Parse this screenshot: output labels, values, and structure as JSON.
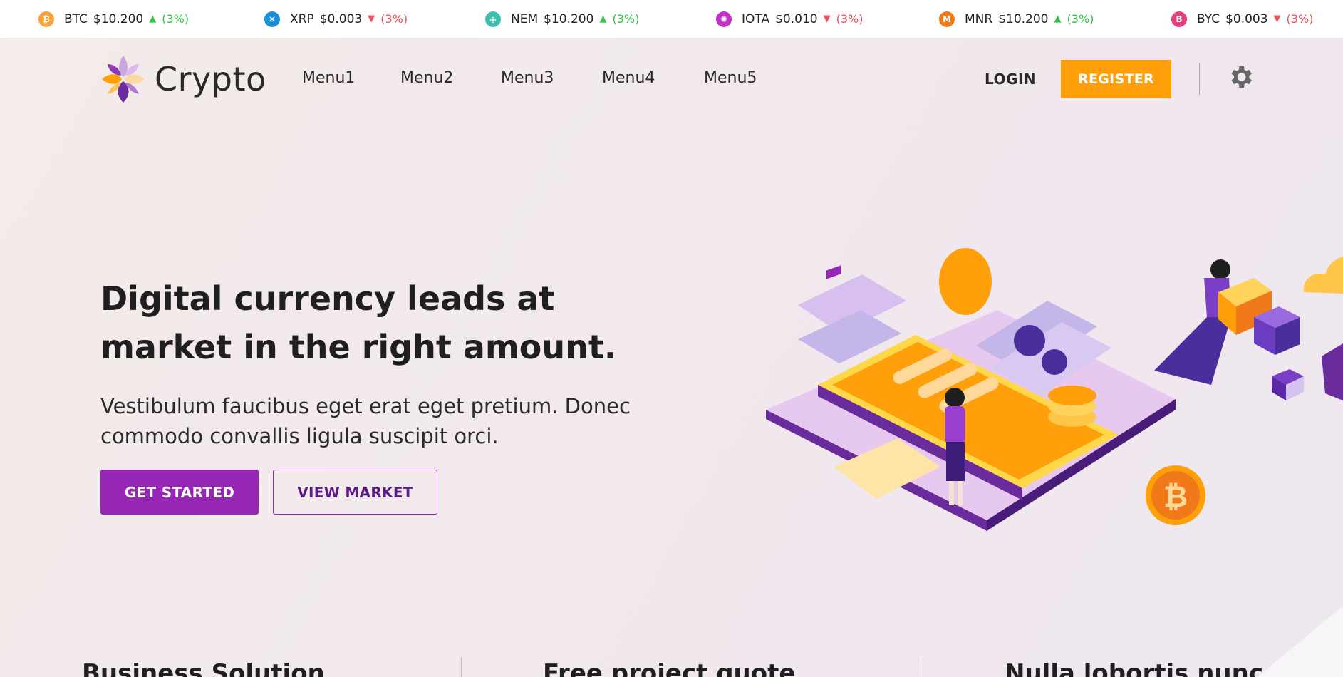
{
  "ticker": [
    {
      "icon": "bitcoin-coin-icon",
      "symbol": "BTC",
      "price": "$10.200",
      "direction": "up",
      "change": "(3%)",
      "color": "#f7a33a"
    },
    {
      "icon": "xrp-coin-icon",
      "symbol": "XRP",
      "price": "$0.003",
      "direction": "down",
      "change": "(3%)",
      "color": "#1e8fd6"
    },
    {
      "icon": "nem-coin-icon",
      "symbol": "NEM",
      "price": "$10.200",
      "direction": "up",
      "change": "(3%)",
      "color": "#3ec0b0"
    },
    {
      "icon": "iota-coin-icon",
      "symbol": "IOTA",
      "price": "$0.010",
      "direction": "down",
      "change": "(3%)",
      "color": "#c42fc7"
    },
    {
      "icon": "monero-coin-icon",
      "symbol": "MNR",
      "price": "$10.200",
      "direction": "up",
      "change": "(3%)",
      "color": "#f07a1a"
    },
    {
      "icon": "byc-coin-icon",
      "symbol": "BYC",
      "price": "$0.003",
      "direction": "down",
      "change": "(3%)",
      "color": "#e63e7f"
    }
  ],
  "header": {
    "brand": "Crypto",
    "menu": [
      "Menu1",
      "Menu2",
      "Menu3",
      "Menu4",
      "Menu5"
    ],
    "login": "LOGIN",
    "register": "REGISTER"
  },
  "hero": {
    "title": "Digital currency leads at market in the right amount.",
    "subtitle": "Vestibulum faucibus eget erat eget pretium. Donec commodo convallis ligula suscipit orci.",
    "primary_button": "GET STARTED",
    "secondary_button": "VIEW MARKET"
  },
  "features": [
    "Business Solution",
    "Free project quote",
    "Nulla lobortis nunc"
  ],
  "colors": {
    "accent_orange": "#ff9f0a",
    "accent_purple": "#9627b5",
    "up": "#35c24b",
    "down": "#f0505a"
  }
}
